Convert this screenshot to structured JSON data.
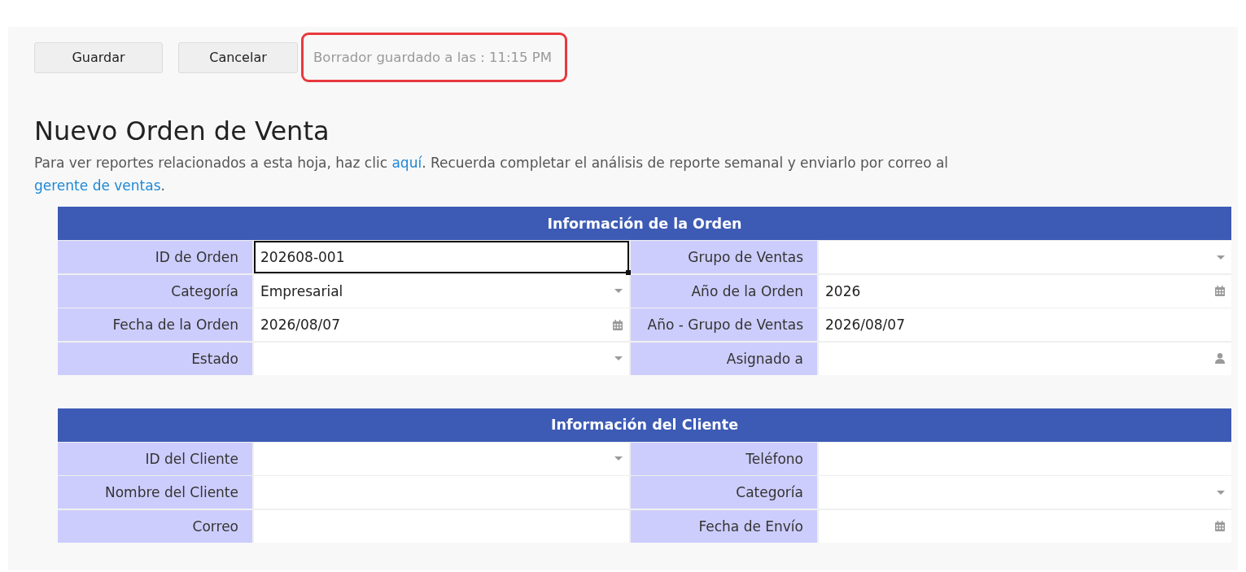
{
  "toolbar": {
    "buttons": [
      "Guardar",
      "Cancelar"
    ],
    "draft_status": {
      "text": "Borrador guardado a las : 11:15 PM",
      "highlighted": true
    }
  },
  "page": {
    "title": "Nuevo Orden de Venta",
    "description": [
      {
        "kind": "text",
        "text": "Para ver reportes relacionados a esta hoja, haz clic "
      },
      {
        "kind": "link",
        "text": "aquí"
      },
      {
        "kind": "text",
        "text": ". Recuerda completar el análisis de reporte semanal y enviarlo por correo al "
      },
      {
        "kind": "link",
        "text": "gerente de ventas"
      },
      {
        "kind": "text",
        "text": "."
      }
    ]
  },
  "sections": [
    {
      "title": "Información de la Orden",
      "fields": [
        {
          "label": "ID de Orden",
          "value": "202608-001",
          "kind": "text",
          "selected": true
        },
        {
          "label": "Grupo de Ventas",
          "kind": "dropdown",
          "selected": false
        },
        {
          "label": "Categoría",
          "value": "Empresarial",
          "kind": "dropdown",
          "selected": false
        },
        {
          "label": "Año de la Orden",
          "value": "2026",
          "kind": "date",
          "selected": false
        },
        {
          "label": "Fecha de la Orden",
          "value": "2026/08/07",
          "kind": "date",
          "selected": false
        },
        {
          "label": "Año - Grupo de Ventas",
          "value": "2026/08/07",
          "kind": "text",
          "selected": false
        },
        {
          "label": "Estado",
          "kind": "dropdown",
          "selected": false
        },
        {
          "label": "Asignado a",
          "kind": "person",
          "selected": false
        }
      ]
    },
    {
      "title": "Información del Cliente",
      "fields": [
        {
          "label": "ID del Cliente",
          "kind": "dropdown",
          "selected": false
        },
        {
          "label": "Teléfono",
          "kind": "text",
          "selected": false
        },
        {
          "label": "Nombre del Cliente",
          "kind": "text",
          "selected": false
        },
        {
          "label": "Categoría",
          "kind": "dropdown",
          "selected": false
        },
        {
          "label": "Correo",
          "kind": "text",
          "selected": false
        },
        {
          "label": "Fecha de Envío",
          "kind": "date",
          "selected": false
        }
      ]
    }
  ]
}
